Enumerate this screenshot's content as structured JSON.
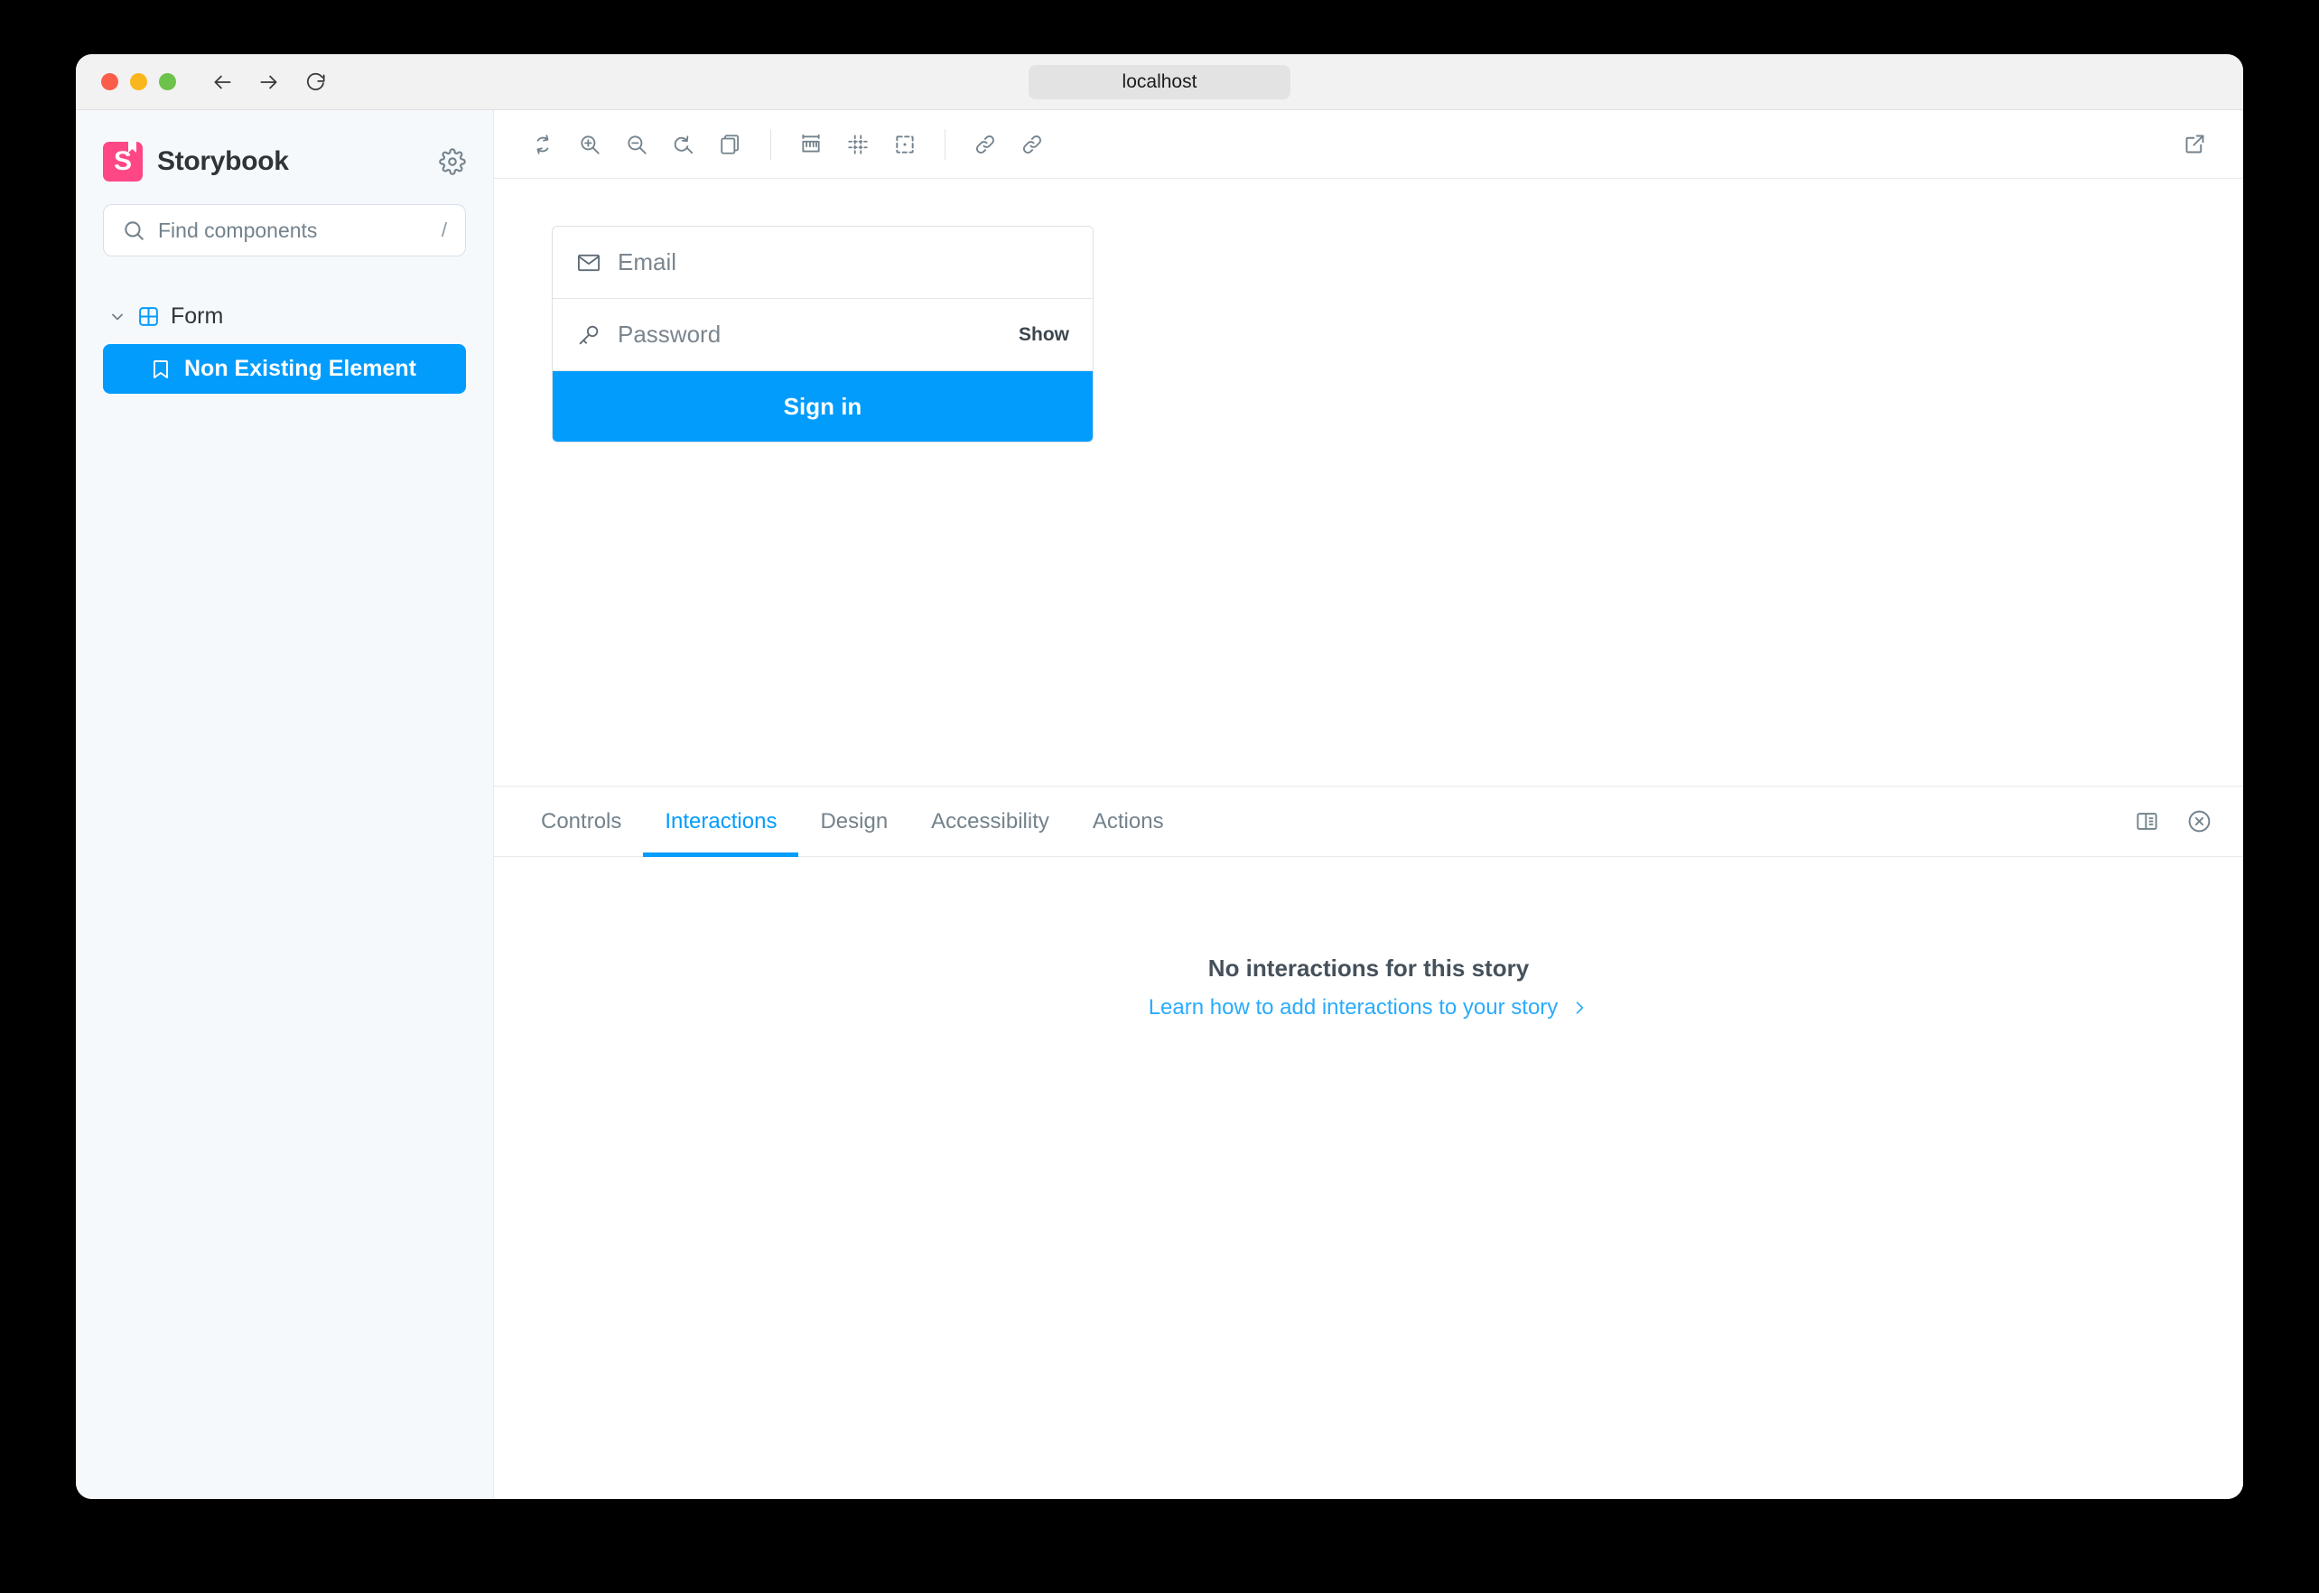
{
  "browser": {
    "url": "localhost",
    "controls": {
      "close": "close-window",
      "minimize": "minimize-window",
      "maximize": "maximize-window",
      "back": "back-arrow-icon",
      "forward": "forward-arrow-icon",
      "reload": "reload-icon"
    }
  },
  "sidebar": {
    "brand": "Storybook",
    "settings_icon": "gear-icon",
    "search": {
      "placeholder": "Find components",
      "value": "",
      "shortcut": "/",
      "icon": "search-icon"
    },
    "tree": {
      "group": {
        "label": "Form",
        "icon": "component-grid-icon",
        "chevron": "chevron-down-icon",
        "expanded": true
      },
      "items": [
        {
          "label": "Non Existing Element",
          "icon": "bookmark-icon",
          "selected": true
        }
      ]
    }
  },
  "toolbar": {
    "items": [
      {
        "name": "remount-icon",
        "title": "Remount component"
      },
      {
        "name": "zoom-in-icon",
        "title": "Zoom in"
      },
      {
        "name": "zoom-out-icon",
        "title": "Zoom out"
      },
      {
        "name": "zoom-reset-icon",
        "title": "Reset zoom"
      },
      {
        "name": "backgrounds-icon",
        "title": "Change background"
      },
      {
        "name": "measure-icon",
        "title": "Enable measure"
      },
      {
        "name": "grid-icon",
        "title": "Apply a grid to the preview"
      },
      {
        "name": "outline-icon",
        "title": "Apply outlines to the preview"
      },
      {
        "name": "link-icon",
        "title": "Go full screen"
      },
      {
        "name": "link-alt-icon",
        "title": "Copy canvas link"
      }
    ],
    "open_new_tab": "open-in-new-icon"
  },
  "story": {
    "form": {
      "email": {
        "placeholder": "Email",
        "value": "",
        "icon": "envelope-icon"
      },
      "password": {
        "placeholder": "Password",
        "value": "",
        "icon": "key-icon",
        "show_label": "Show"
      },
      "submit_label": "Sign in"
    }
  },
  "panel": {
    "tabs": [
      {
        "label": "Controls",
        "active": false
      },
      {
        "label": "Interactions",
        "active": true
      },
      {
        "label": "Design",
        "active": false
      },
      {
        "label": "Accessibility",
        "active": false
      },
      {
        "label": "Actions",
        "active": false
      }
    ],
    "actions": [
      {
        "name": "panel-position-icon"
      },
      {
        "name": "close-panel-icon"
      }
    ],
    "empty": {
      "title": "No interactions for this story",
      "link": "Learn how to add interactions to your story",
      "link_chevron": "chevron-right-icon"
    }
  },
  "colors": {
    "brand_pink": "#FF4785",
    "accent_blue": "#029CFD",
    "link_blue": "#29ABFC",
    "sidebar_bg": "#F6F9FC",
    "text_dark": "#2E3438",
    "text_muted": "#73828C"
  }
}
